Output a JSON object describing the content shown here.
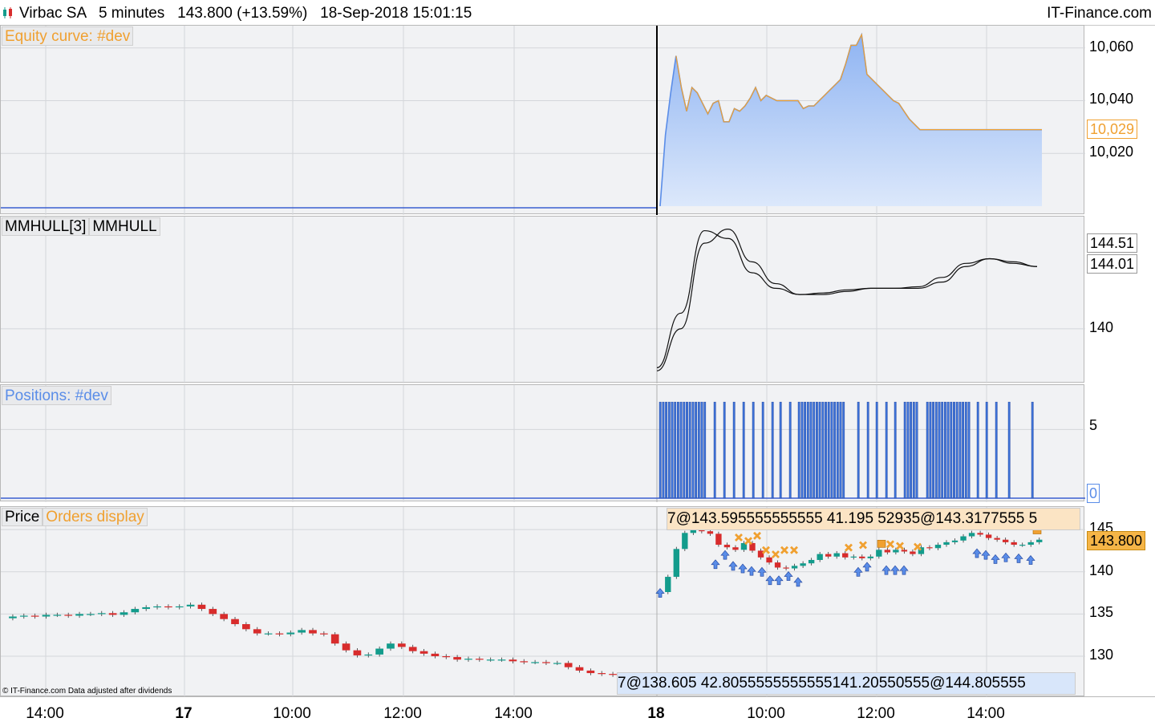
{
  "header": {
    "instrument": "Virbac SA",
    "timeframe": "5 minutes",
    "price": "143.800",
    "change": "(+13.59%)",
    "datetime": "18-Sep-2018 15:01:15",
    "brand": "IT-Finance.com"
  },
  "credit": "© IT-Finance.com Data adjusted after dividends",
  "x_axis": {
    "labels": [
      {
        "text": "14:00",
        "bold": false
      },
      {
        "text": "17",
        "bold": true
      },
      {
        "text": "10:00",
        "bold": false
      },
      {
        "text": "12:00",
        "bold": false
      },
      {
        "text": "14:00",
        "bold": false
      },
      {
        "text": "18",
        "bold": true
      },
      {
        "text": "10:00",
        "bold": false
      },
      {
        "text": "12:00",
        "bold": false
      },
      {
        "text": "14:00",
        "bold": false
      }
    ]
  },
  "colors": {
    "equity_line": "#5a8de8",
    "equity_fill_top": "#8fb4f2",
    "equity_fill_bottom": "#dce8fb",
    "orange": "#f0a030",
    "blue_bar": "#3d72d8",
    "up_candle": "#139c8c",
    "down_candle": "#d82c2c",
    "panel_bg": "#f1f2f4",
    "grid": "#d4d6da"
  },
  "panels": {
    "equity": {
      "tag": "Equity curve: #dev",
      "ticks": [
        "10,060",
        "10,040",
        "10,020"
      ],
      "last_value": "10,029"
    },
    "mmhull": {
      "tag1": "MMHULL[3]",
      "tag2": "MMHULL",
      "ticks": [
        "140"
      ],
      "value1": "144.51",
      "value2": "144.01"
    },
    "positions": {
      "tag": "Positions: #dev",
      "ticks": [
        "5"
      ],
      "zero_label": "0"
    },
    "price": {
      "tag1": "Price",
      "tag2": "Orders display",
      "ticks": [
        "145",
        "140",
        "135",
        "130"
      ],
      "last_value": "143.800",
      "order_bar_top": "7@143.595555555555 41.195 52935@143.3177555 5",
      "order_bar_bottom": "7@138.605 42.8055555555555141.20550555@144.805555"
    }
  },
  "chart_data": [
    {
      "type": "area",
      "title": "Equity curve: #dev",
      "ylim": [
        10000,
        10066
      ],
      "x": [
        "18 09:00",
        "09:05",
        "09:10",
        "09:15",
        "09:20",
        "09:25",
        "09:30",
        "09:35",
        "09:40",
        "09:45",
        "09:50",
        "09:55",
        "10:00",
        "10:05",
        "10:10",
        "10:15",
        "10:20",
        "10:25",
        "10:30",
        "10:35",
        "10:40",
        "10:45",
        "10:50",
        "10:55",
        "11:00",
        "11:05",
        "11:10",
        "11:15",
        "11:20",
        "11:25",
        "11:30",
        "11:35",
        "11:40",
        "11:45",
        "11:50",
        "11:55",
        "12:00",
        "12:05",
        "12:10",
        "12:15",
        "12:20",
        "12:25",
        "12:30",
        "12:35",
        "12:40",
        "12:45",
        "12:50",
        "12:55",
        "13:00",
        "13:05",
        "13:10",
        "13:15",
        "13:20",
        "13:25",
        "13:30",
        "13:35",
        "13:40",
        "13:45",
        "13:50",
        "13:55",
        "14:00",
        "14:05",
        "14:10",
        "14:15",
        "14:20",
        "14:25",
        "14:30",
        "14:35",
        "14:40",
        "14:45",
        "14:50",
        "14:55",
        "15:00"
      ],
      "values": [
        10000,
        10027,
        10043,
        10057,
        10045,
        10036,
        10045,
        10043,
        10039,
        10035,
        10039,
        10040,
        10032,
        10032,
        10037,
        10036,
        10038,
        10041,
        10045,
        10040,
        10042,
        10041,
        10040,
        10040,
        10040,
        10040,
        10040,
        10037,
        10038,
        10038,
        10040,
        10042,
        10044,
        10046,
        10048,
        10054,
        10061,
        10061,
        10065,
        10050,
        10048,
        10046,
        10044,
        10042,
        10040,
        10039,
        10036,
        10033,
        10031,
        10029,
        10029,
        10029,
        10029,
        10029,
        10029,
        10029,
        10029,
        10029,
        10029,
        10029,
        10029,
        10029,
        10029,
        10029,
        10029,
        10029,
        10029,
        10029,
        10029,
        10029,
        10029,
        10029,
        10029
      ],
      "last": 10029
    },
    {
      "type": "line",
      "title": "MMHULL[3] MMHULL",
      "series": [
        {
          "name": "MMHULL[3]",
          "values": [
            137.5,
            141.0,
            146.3,
            145.8,
            143.6,
            142.6,
            142.2,
            142.3,
            142.5,
            142.6,
            142.6,
            142.7,
            143.3,
            144.2,
            144.5,
            144.2,
            144.0
          ]
        },
        {
          "name": "MMHULL",
          "values": [
            137.3,
            140.0,
            145.5,
            146.4,
            144.3,
            142.9,
            142.2,
            142.2,
            142.4,
            142.6,
            142.6,
            142.6,
            143.0,
            144.0,
            144.5,
            144.3,
            144.0
          ]
        }
      ],
      "ylim": [
        136.9,
        147.0
      ],
      "last": [
        144.51,
        144.01
      ]
    },
    {
      "type": "bar",
      "title": "Positions: #dev",
      "ylim": [
        0,
        8
      ],
      "values": [
        7,
        7,
        7,
        7,
        7,
        7,
        7,
        7,
        7,
        7,
        7,
        7,
        7,
        7,
        7,
        7,
        7,
        7,
        7,
        7,
        7,
        7,
        7,
        7,
        7,
        7,
        7,
        7,
        7,
        7,
        7,
        7,
        7,
        7,
        7,
        7,
        7,
        7,
        7,
        7,
        7,
        7,
        7,
        7,
        7,
        7,
        7,
        7,
        7,
        7,
        7,
        7,
        7,
        7,
        7,
        7,
        7,
        7,
        7,
        7,
        7,
        7,
        7,
        7,
        7,
        7,
        7,
        7,
        7,
        7,
        7,
        7,
        7,
        7,
        7,
        7,
        7,
        7,
        7,
        7
      ]
    },
    {
      "type": "bar",
      "title": "Price",
      "ylim": [
        126.2,
        147.1
      ],
      "last": 143.8,
      "candles_day1": [
        134.7,
        134.8,
        134.7,
        134.9,
        134.9,
        134.8,
        135.0,
        135.0,
        135.1,
        134.9,
        135.2,
        135.6,
        135.8,
        135.9,
        135.8,
        135.9,
        136.1,
        135.6,
        135.0,
        134.4,
        133.8,
        133.2,
        132.7,
        132.7,
        132.6,
        132.8,
        133.1,
        132.7,
        132.6,
        131.5,
        130.7,
        130.1,
        130.2,
        130.9,
        131.5,
        131.1,
        130.6,
        130.3,
        130.0,
        129.9,
        129.6,
        129.7,
        129.6,
        129.6,
        129.6,
        129.4,
        129.3,
        129.3,
        129.2,
        129.2,
        128.7,
        128.3,
        128.0,
        127.9,
        127.8
      ],
      "candles_day2": [
        137.6,
        139.4,
        142.7,
        144.6,
        145.6,
        144.8,
        144.5,
        143.2,
        142.9,
        142.6,
        143.4,
        142.5,
        141.7,
        141.1,
        140.5,
        140.4,
        140.7,
        141.0,
        141.4,
        142.1,
        141.8,
        142.2,
        141.7,
        141.8,
        141.6,
        141.8,
        142.6,
        142.3,
        142.6,
        142.4,
        142.1,
        142.9,
        142.8,
        143.2,
        143.5,
        143.7,
        144.2,
        144.6,
        144.4,
        144.0,
        143.8,
        143.5,
        143.2,
        143.2,
        143.5,
        143.8
      ]
    }
  ]
}
